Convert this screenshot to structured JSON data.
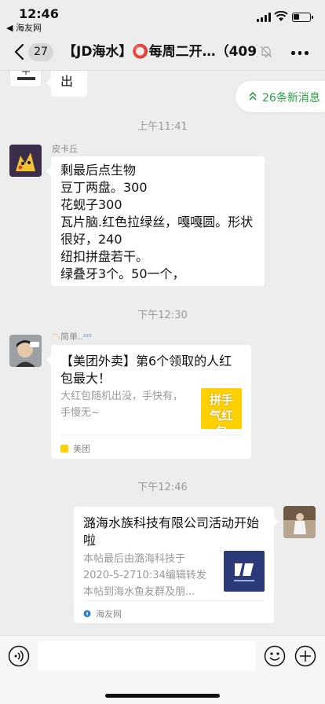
{
  "status_bar": {
    "time": "12:46",
    "back_app": "◀ 海友网"
  },
  "nav": {
    "count": "27",
    "title": "【JD海水】⭕每周二开…（409）"
  },
  "new_messages": "26条新消息",
  "messages": {
    "m0_text": "出",
    "ts1": "上午11:41",
    "m1_sender": "皮卡丘",
    "m1_text": "剩最后点生物\n豆丁两盘。300\n花蚬子300\n瓦片脑.红色拉绿丝，嘎嘎圆。形状很好，240\n纽扣拼盘若干。\n绿叠牙3个。50一个，",
    "ts2": "下午12:30",
    "m2_sender": "简单..",
    "m2_card_title": "【美团外卖】第6个领取的人红包最大！",
    "m2_card_desc": "大红包随机出没，手快有，手慢无~",
    "m2_card_thumb_text": "拼手气红包",
    "m2_card_source": "美团",
    "ts3": "下午12:46",
    "m3_card_title": "潞海水族科技有限公司活动开始啦",
    "m3_card_desc": "本帖最后由潞海科技于2020-5-2710:34编辑转发本帖到海水鱼友群及朋...",
    "m3_card_source": "海友网"
  },
  "icons": {
    "back": "chevron-left-icon",
    "mute": "bell-off-icon",
    "more": "more-dots-icon",
    "voice": "voice-icon",
    "emoji": "emoji-icon",
    "plus": "plus-icon"
  },
  "colors": {
    "accent_green": "#2ba245",
    "bg": "#ededed",
    "meituan_yellow": "#ffd100"
  }
}
